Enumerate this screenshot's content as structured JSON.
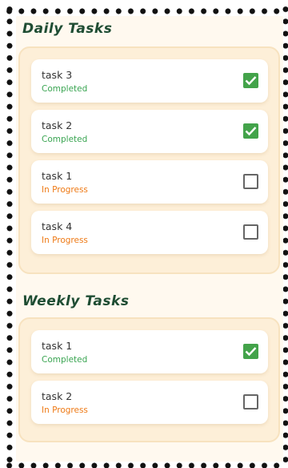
{
  "daily": {
    "title": "Daily Tasks",
    "tasks": [
      {
        "name": "task 3",
        "status": "Completed",
        "checked": true
      },
      {
        "name": "task 2",
        "status": "Completed",
        "checked": true
      },
      {
        "name": "task 1",
        "status": "In Progress",
        "checked": false
      },
      {
        "name": "task 4",
        "status": "In Progress",
        "checked": false
      }
    ]
  },
  "weekly": {
    "title": "Weekly Tasks",
    "tasks": [
      {
        "name": "task 1",
        "status": "Completed",
        "checked": true
      },
      {
        "name": "task 2",
        "status": "In Progress",
        "checked": false
      }
    ]
  },
  "colors": {
    "completed": "#3aa552",
    "in_progress": "#ee7a16",
    "title": "#1f4d33",
    "checkbox_checked": "#43a34a"
  }
}
